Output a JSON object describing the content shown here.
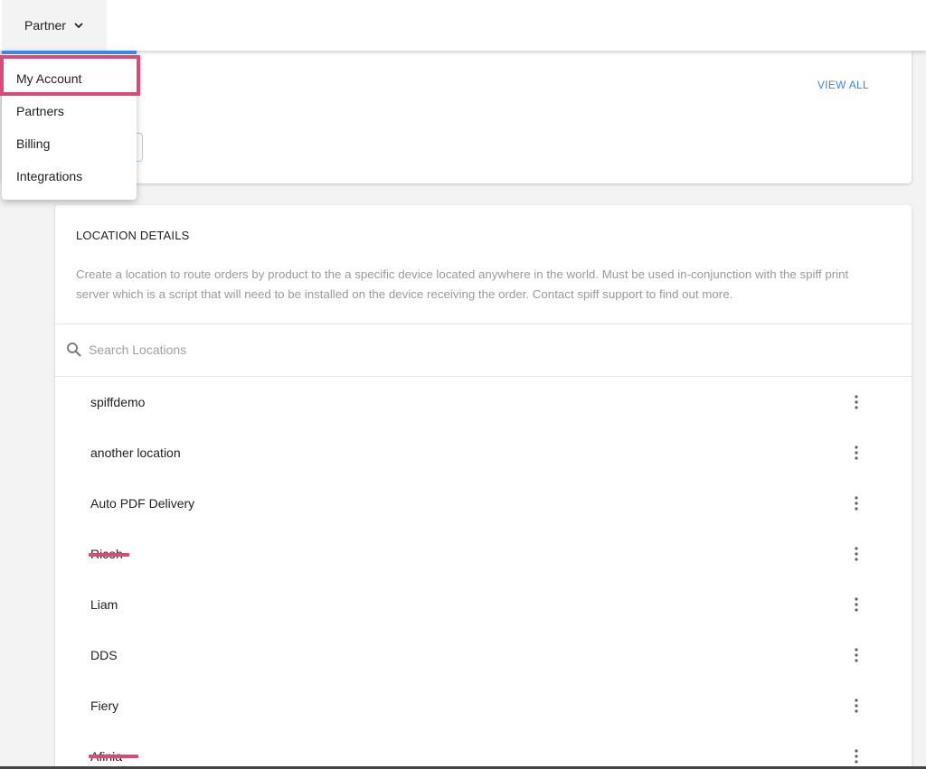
{
  "topbar": {
    "partner_label": "Partner",
    "partner_icon": "chevron-down-icon"
  },
  "dropdown": {
    "items": [
      {
        "label": "My Account",
        "highlighted": true
      },
      {
        "label": "Partners"
      },
      {
        "label": "Billing"
      },
      {
        "label": "Integrations"
      }
    ]
  },
  "top_card": {
    "view_all_label": "VIEW ALL"
  },
  "location_details": {
    "title": "LOCATION DETAILS",
    "description": "Create a location to route orders by product to the a specific device located anywhere in the world. Must be used in-conjunction with the spiff print server which is a script that will need to be installed on the device receiving the order. Contact spiff support to find out more.",
    "search_placeholder": "Search Locations",
    "search_value": "",
    "locations": [
      {
        "name": "spiffdemo",
        "struck_out": false
      },
      {
        "name": "another location",
        "struck_out": false
      },
      {
        "name": "Auto PDF Delivery",
        "struck_out": false
      },
      {
        "name": "Ricoh",
        "struck_out": true
      },
      {
        "name": "Liam",
        "struck_out": false
      },
      {
        "name": "DDS",
        "struck_out": false
      },
      {
        "name": "Fiery",
        "struck_out": false
      },
      {
        "name": "Afinia",
        "struck_out": true
      }
    ]
  },
  "colors": {
    "accent": "#3a86e0",
    "annotation": "#d94a7c",
    "muted_text": "#9a9a9a"
  }
}
